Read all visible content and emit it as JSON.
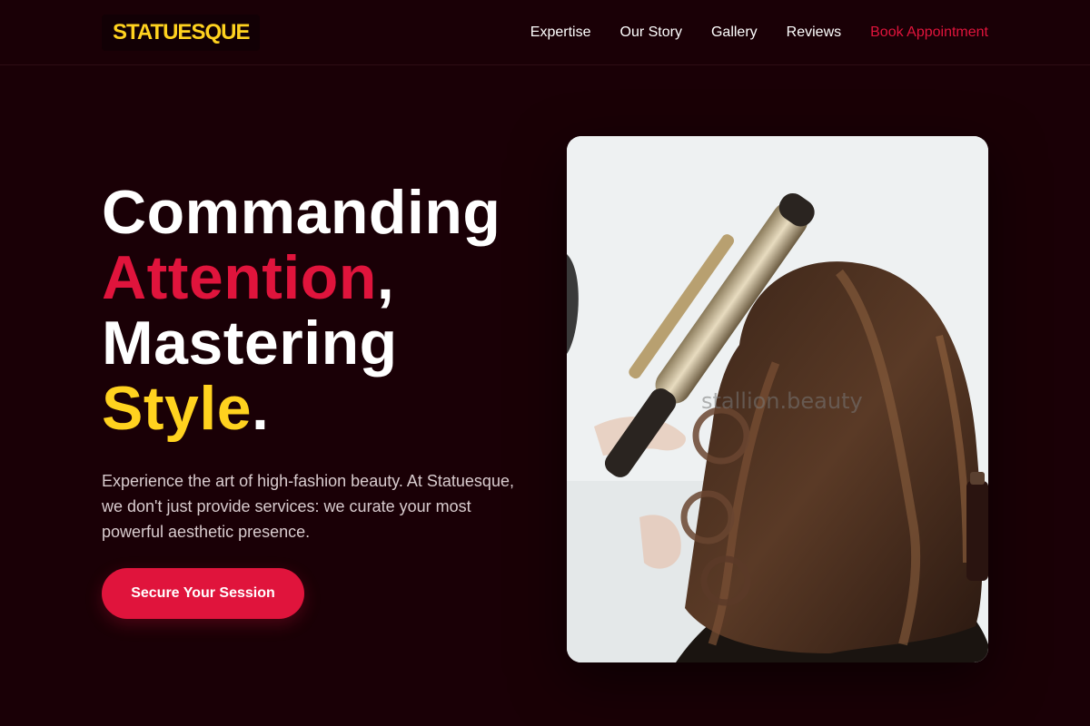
{
  "brand": {
    "logo_text": "STATUESQUE"
  },
  "nav": {
    "items": [
      {
        "label": "Expertise"
      },
      {
        "label": "Our Story"
      },
      {
        "label": "Gallery"
      },
      {
        "label": "Reviews"
      }
    ],
    "cta_label": "Book Appointment"
  },
  "hero": {
    "headline": {
      "line1": "Commanding",
      "line2_accent": "Attention",
      "line2_punct": ",",
      "line3": "Mastering",
      "line4_accent": "Style",
      "line4_punct": "."
    },
    "description": "Experience the art of high-fashion beauty. At Statuesque, we don't just provide services: we curate your most powerful aesthetic presence.",
    "button_label": "Secure Your Session"
  },
  "image": {
    "watermark": "stallion.beauty",
    "subject": "stylist curling long brunette hair with a curling iron"
  },
  "colors": {
    "background": "#1a0006",
    "accent_red": "#e0143c",
    "accent_yellow": "#ffd21f",
    "text_primary": "#ffffff",
    "text_muted": "#d9cccf"
  }
}
